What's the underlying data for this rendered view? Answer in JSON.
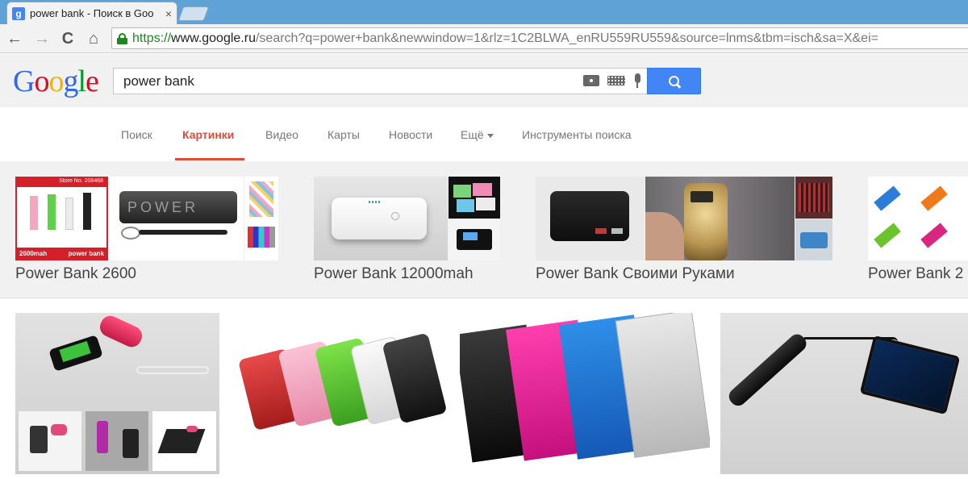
{
  "browser": {
    "tab": {
      "favicon": "g",
      "title": "power bank - Поиск в Goo",
      "close": "×"
    },
    "nav": {
      "back": "←",
      "forward": "→",
      "reload": "C",
      "home": "⌂"
    },
    "url": {
      "scheme": "https://",
      "host": "www.google.ru",
      "rest": "/search?q=power+bank&newwindow=1&rlz=1C2BLWA_enRU559RU559&source=lnms&tbm=isch&sa=X&ei="
    }
  },
  "google": {
    "logo": [
      "G",
      "o",
      "o",
      "g",
      "l",
      "e"
    ],
    "logo_colors": [
      "#3369e8",
      "#d50f25",
      "#eeb211",
      "#3369e8",
      "#009925",
      "#d50f25"
    ],
    "search_value": "power bank"
  },
  "tabs": [
    {
      "label": "Поиск"
    },
    {
      "label": "Картинки",
      "active": true
    },
    {
      "label": "Видео"
    },
    {
      "label": "Карты"
    },
    {
      "label": "Новости"
    },
    {
      "label": "Ещё"
    },
    {
      "label": "Инструменты поиска"
    }
  ],
  "related": [
    {
      "label": "Power Bank 2600"
    },
    {
      "label": "Power Bank 12000mah"
    },
    {
      "label": "Power Bank Своими Руками"
    },
    {
      "label": "Power Bank 2"
    }
  ],
  "thumb_text": {
    "store": "Store No. 208468",
    "capacity": "2600mah",
    "product": "power bank",
    "power": "POWER"
  },
  "colors": {
    "accent_red": "#dd4b39",
    "search_blue": "#4285f4",
    "header_bg": "#f1f1f1"
  }
}
